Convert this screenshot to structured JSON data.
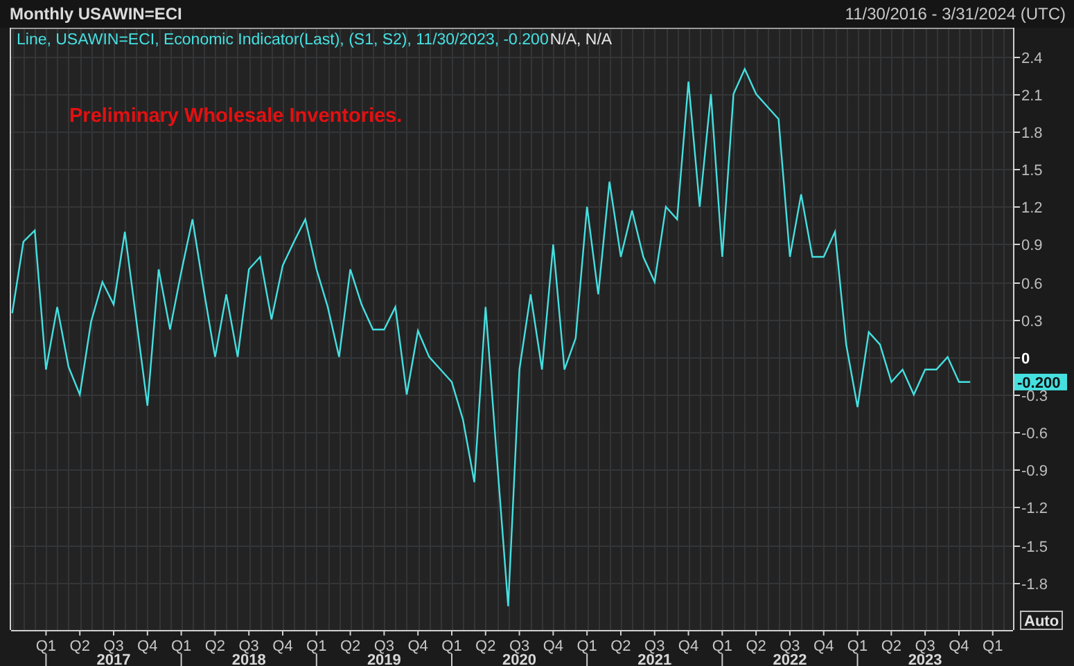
{
  "header": {
    "title": "Monthly USAWIN=ECI",
    "date_range": "11/30/2016 - 3/31/2024 (UTC)"
  },
  "chart": {
    "legend": {
      "series_text": "Line, USAWIN=ECI, Economic Indicator(Last), (S1, S2), 11/30/2023, -0.200",
      "extra_text": "N/A, N/A"
    },
    "last_value_badge": "-0.200",
    "auto_button": "Auto",
    "year_labels": [
      "2017",
      "2018",
      "2019",
      "2020",
      "2021",
      "2022",
      "2023"
    ],
    "chart_data": {
      "type": "line",
      "title": "Preliminary Wholesale Inventories.",
      "categories": [
        null,
        null,
        null,
        "Q1",
        null,
        null,
        "Q2",
        null,
        null,
        "Q3",
        null,
        null,
        "Q4",
        null,
        null,
        "Q1",
        null,
        null,
        "Q2",
        null,
        null,
        "Q3",
        null,
        null,
        "Q4",
        null,
        null,
        "Q1",
        null,
        null,
        "Q2",
        null,
        null,
        "Q3",
        null,
        null,
        "Q4",
        null,
        null,
        "Q1",
        null,
        null,
        "Q2",
        null,
        null,
        "Q3",
        null,
        null,
        "Q4",
        null,
        null,
        "Q1",
        null,
        null,
        "Q2",
        null,
        null,
        "Q3",
        null,
        null,
        "Q4",
        null,
        null,
        "Q1",
        null,
        null,
        "Q2",
        null,
        null,
        "Q3",
        null,
        null,
        "Q4",
        null,
        null,
        "Q1",
        null,
        null,
        "Q2",
        null,
        null,
        "Q3",
        null,
        null,
        "Q4",
        null,
        null,
        "Q1"
      ],
      "series": [
        {
          "color": "#45e0e0",
          "values": [
            0.35,
            0.92,
            1.01,
            -0.1,
            0.4,
            -0.08,
            -0.3,
            0.28,
            0.6,
            0.42,
            1.0,
            0.3,
            -0.39,
            0.7,
            0.22,
            0.68,
            1.1,
            0.53,
            0.0,
            0.5,
            0.0,
            0.7,
            0.8,
            0.3,
            0.73,
            0.92,
            1.1,
            0.7,
            0.4,
            0.0,
            0.7,
            0.42,
            0.22,
            0.22,
            0.4,
            -0.3,
            0.21,
            0.0,
            -0.1,
            -0.2,
            -0.5,
            -1.0,
            0.4,
            -0.8,
            -1.99,
            -0.1,
            0.5,
            -0.1,
            0.9,
            -0.1,
            0.15,
            1.2,
            0.5,
            1.4,
            0.8,
            1.17,
            0.8,
            0.6,
            1.2,
            1.1,
            2.2,
            1.2,
            2.1,
            0.8,
            2.1,
            2.3,
            2.1,
            2.0,
            1.9,
            0.8,
            1.3,
            0.8,
            0.8,
            1.0,
            0.1,
            -0.4,
            0.2,
            0.1,
            -0.2,
            -0.1,
            -0.3,
            -0.1,
            -0.1,
            0.0,
            -0.2,
            -0.2,
            null,
            null
          ]
        }
      ],
      "grid": true,
      "ylim": [
        -2.18,
        2.63
      ],
      "yticks": [
        {
          "value": 2.4,
          "label": "2.4"
        },
        {
          "value": 2.1,
          "label": "2.1"
        },
        {
          "value": 1.8,
          "label": "1.8"
        },
        {
          "value": 1.5,
          "label": "1.5"
        },
        {
          "value": 1.2,
          "label": "1.2"
        },
        {
          "value": 0.9,
          "label": "0.9"
        },
        {
          "value": 0.6,
          "label": "0.6"
        },
        {
          "value": 0.3,
          "label": "0.3"
        },
        {
          "value": 0,
          "label": "0"
        },
        {
          "value": -0.3,
          "label": "-0.3"
        },
        {
          "value": -0.6,
          "label": "-0.6"
        },
        {
          "value": -0.9,
          "label": "-0.9"
        },
        {
          "value": -1.2,
          "label": "-1.2"
        },
        {
          "value": -1.5,
          "label": "-1.5"
        },
        {
          "value": -1.8,
          "label": "-1.8"
        }
      ]
    }
  }
}
